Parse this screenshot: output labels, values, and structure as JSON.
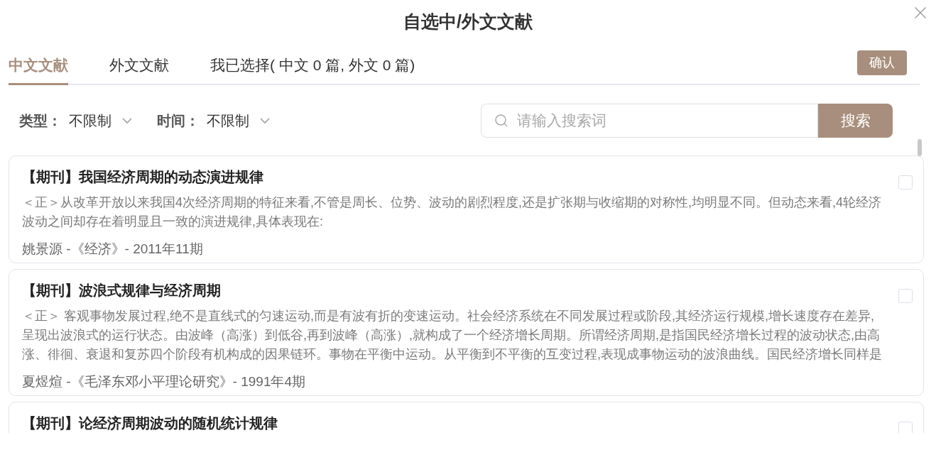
{
  "dialog": {
    "title": "自选中/外文文献"
  },
  "tabs": [
    {
      "label": "中文文献",
      "selected": true
    },
    {
      "label": "外文文献",
      "selected": false
    },
    {
      "label": "我已选择( 中文 0 篇, 外文 0 篇)",
      "selected": false
    }
  ],
  "confirm_button": "确认",
  "filters": [
    {
      "label": "类型：",
      "value": "不限制"
    },
    {
      "label": "时间：",
      "value": "不限制"
    }
  ],
  "search": {
    "placeholder": "请输入搜索词",
    "button": "搜索"
  },
  "articles": [
    {
      "title": "【期刊】我国经济周期的动态演进规律",
      "abstract_lines": [
        "＜正＞从改革开放以来我国4次经济周期的特征来看,不管是周长、位势、波动的剧烈程度,还是扩张期与收缩期的对称性,均明显不同。但动态来看,4轮经济",
        "波动之间却存在着明显且一致的演进规律,具体表现在:"
      ],
      "source": "姚景源 -《经济》- 2011年11期",
      "checked": false
    },
    {
      "title": "【期刊】波浪式规律与经济周期",
      "abstract_lines": [
        "＜正＞ 客观事物发展过程,绝不是直线式的匀速运动,而是有波有折的变速运动。社会经济系统在不同发展过程或阶段,其经济运行规模,增长速度存在差异,",
        "呈现出波浪式的运行状态。由波峰（高涨）到低谷,再到波峰（高涨）,就构成了一个经济增长周期。所谓经济周期,是指国民经济增长过程的波动状态,由高",
        "涨、徘徊、衰退和复苏四个阶段有机构成的因果链环。事物在平衡中运动。从平衡到不平衡的互变过程,表现成事物运动的波浪曲线。国民经济增长同样是"
      ],
      "source": "夏煜煊 -《毛泽东邓小平理论研究》- 1991年4期",
      "checked": false
    },
    {
      "title": "【期刊】论经济周期波动的随机统计规律",
      "checked": false
    }
  ]
}
